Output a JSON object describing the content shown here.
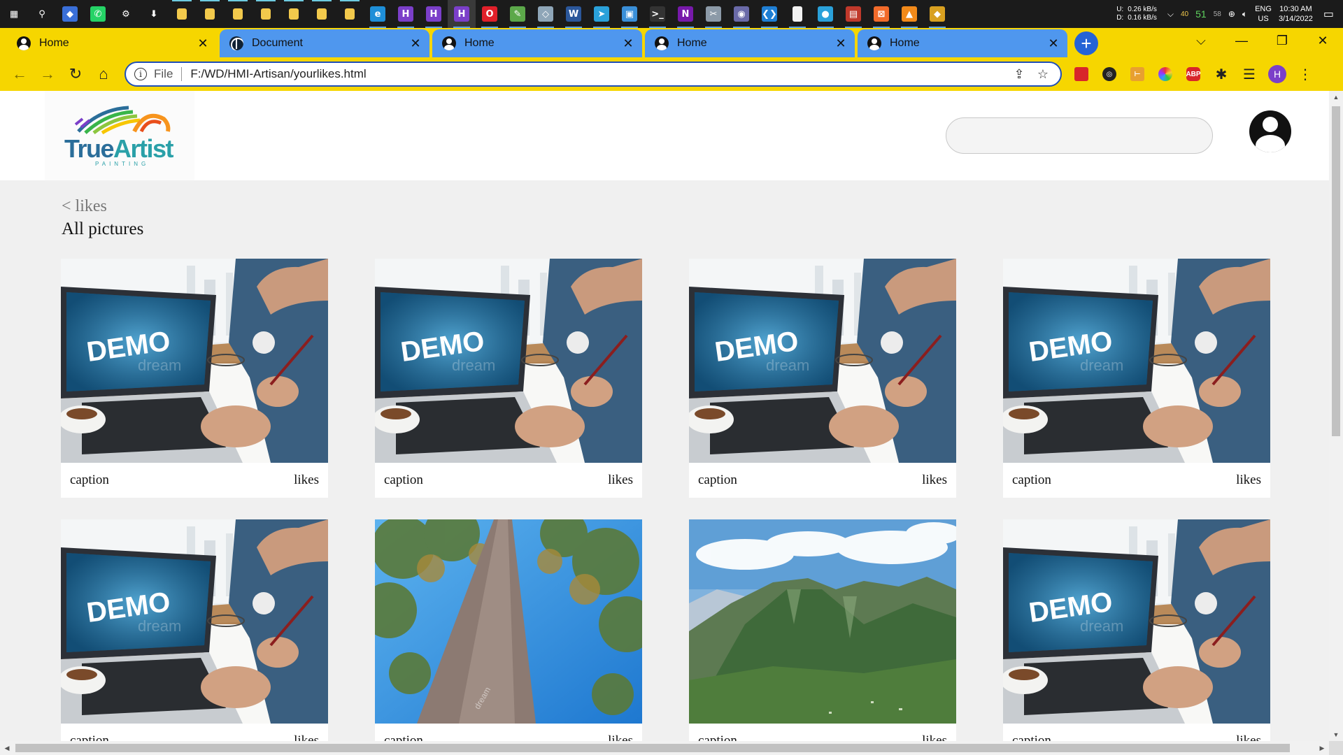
{
  "taskbar": {
    "apps": [
      {
        "icon": "windows-start-icon",
        "glyph": "▦",
        "color": "#1b1b1b"
      },
      {
        "icon": "search-icon",
        "glyph": "⚲",
        "color": "#1b1b1b"
      },
      {
        "icon": "defender-icon",
        "glyph": "◆",
        "color": "#3a6fd8"
      },
      {
        "icon": "whatsapp-icon",
        "glyph": "✆",
        "color": "#25d366"
      },
      {
        "icon": "settings-gear-icon",
        "glyph": "⚙",
        "color": "#1b1b1b"
      },
      {
        "icon": "download-arrow-icon",
        "glyph": "⬇",
        "color": "#1b1b1b"
      },
      {
        "icon": "folder-icon",
        "glyph": "",
        "color": "#f2c94c"
      },
      {
        "icon": "folder-icon",
        "glyph": "",
        "color": "#f2c94c"
      },
      {
        "icon": "folder-icon",
        "glyph": "",
        "color": "#f2c94c"
      },
      {
        "icon": "folder-icon",
        "glyph": "",
        "color": "#f2c94c"
      },
      {
        "icon": "folder-icon",
        "glyph": "",
        "color": "#f2c94c"
      },
      {
        "icon": "folder-icon",
        "glyph": "",
        "color": "#f2c94c"
      },
      {
        "icon": "folder-icon",
        "glyph": "",
        "color": "#f2c94c"
      },
      {
        "icon": "edge-browser-icon",
        "glyph": "e",
        "color": "#1e8fd8"
      },
      {
        "icon": "chrome-profile-icon",
        "glyph": "H",
        "color": "#7b3fc9"
      },
      {
        "icon": "chrome-profile-icon",
        "glyph": "H",
        "color": "#7b3fc9"
      },
      {
        "icon": "chrome-profile-icon",
        "glyph": "H",
        "color": "#7b3fc9"
      },
      {
        "icon": "opera-icon",
        "glyph": "O",
        "color": "#e0202a"
      },
      {
        "icon": "notepad-icon",
        "glyph": "✎",
        "color": "#5ca84a"
      },
      {
        "icon": "app-icon",
        "glyph": "◇",
        "color": "#8fa6b8"
      },
      {
        "icon": "word-icon",
        "glyph": "W",
        "color": "#2b579a"
      },
      {
        "icon": "telegram-icon",
        "glyph": "➤",
        "color": "#2aa1da"
      },
      {
        "icon": "remote-desktop-icon",
        "glyph": "▣",
        "color": "#3a8fd8"
      },
      {
        "icon": "terminal-icon",
        "glyph": ">_",
        "color": "#333"
      },
      {
        "icon": "onenote-icon",
        "glyph": "N",
        "color": "#7719aa"
      },
      {
        "icon": "snipping-tool-icon",
        "glyph": "✂",
        "color": "#8c9aa8"
      },
      {
        "icon": "app-icon",
        "glyph": "◉",
        "color": "#6a6aa8"
      },
      {
        "icon": "vscode-icon",
        "glyph": "❮❯",
        "color": "#1f7fd4"
      },
      {
        "icon": "file-icon",
        "glyph": "",
        "color": "#f2f2f2"
      },
      {
        "icon": "maps-pin-icon",
        "glyph": "●",
        "color": "#2aa1da"
      },
      {
        "icon": "app-icon",
        "glyph": "▤",
        "color": "#c0392b"
      },
      {
        "icon": "xampp-icon",
        "glyph": "⊠",
        "color": "#f26b2a"
      },
      {
        "icon": "vlc-cone-icon",
        "glyph": "▲",
        "color": "#f28a1a"
      },
      {
        "icon": "app-icon",
        "glyph": "◆",
        "color": "#d8a020"
      }
    ],
    "net_labels": [
      "U:",
      "D:"
    ],
    "net_values": [
      "0.26 kB/s",
      "0.16 kB/s"
    ],
    "tray_a": "40",
    "tray_b": "51",
    "tray_c": "58",
    "lang_top": "ENG",
    "lang_bottom": "US",
    "time": "10:30 AM",
    "date": "3/14/2022"
  },
  "tabs": [
    {
      "title": "Home",
      "active": true,
      "favicon": "profile"
    },
    {
      "title": "Document",
      "active": false,
      "favicon": "globe"
    },
    {
      "title": "Home",
      "active": false,
      "favicon": "profile"
    },
    {
      "title": "Home",
      "active": false,
      "favicon": "profile"
    },
    {
      "title": "Home",
      "active": false,
      "favicon": "profile"
    }
  ],
  "address": {
    "scheme": "File",
    "url": "F:/WD/HMI-Artisan/yourlikes.html"
  },
  "profile_initial": "H",
  "site": {
    "logo_main": "True",
    "logo_accent": "Artist",
    "logo_sub": "PAINTING",
    "search_placeholder": "",
    "back_label": "< likes",
    "section_title": "All pictures"
  },
  "cards": [
    {
      "image": "demo-laptop",
      "caption": "caption",
      "likes": "likes"
    },
    {
      "image": "demo-laptop",
      "caption": "caption",
      "likes": "likes"
    },
    {
      "image": "demo-laptop",
      "caption": "caption",
      "likes": "likes"
    },
    {
      "image": "demo-laptop",
      "caption": "caption",
      "likes": "likes"
    },
    {
      "image": "demo-laptop",
      "caption": "caption",
      "likes": "likes"
    },
    {
      "image": "tree-trunk",
      "caption": "caption",
      "likes": "likes"
    },
    {
      "image": "mountain",
      "caption": "caption",
      "likes": "likes"
    },
    {
      "image": "demo-laptop",
      "caption": "caption",
      "likes": "likes"
    }
  ],
  "demo_watermark": "DEMO",
  "stock_watermark": "dream",
  "colors": {
    "chrome_accent": "#f6d600",
    "tab_inactive": "#4f97ee",
    "page_bg": "#f0f0f0"
  }
}
